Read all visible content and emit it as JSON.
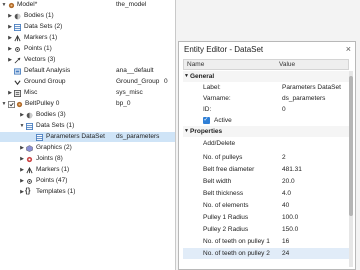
{
  "tree": {
    "rows": [
      {
        "label": "Model*",
        "value": "the_model"
      },
      {
        "label": "Bodies (1)",
        "value": ""
      },
      {
        "label": "Data Sets (2)",
        "value": ""
      },
      {
        "label": "Markers (1)",
        "value": ""
      },
      {
        "label": "Points (1)",
        "value": ""
      },
      {
        "label": "Vectors (3)",
        "value": ""
      },
      {
        "label": "Default Analysis",
        "value": "ana__default"
      },
      {
        "label": "Ground Group",
        "value": "Ground_Group",
        "extra": "0"
      },
      {
        "label": "Misc",
        "value": "sys_misc"
      },
      {
        "label": "BeltPulley 0",
        "value": "bp_0"
      },
      {
        "label": "Bodies (3)",
        "value": ""
      },
      {
        "label": "Data Sets (1)",
        "value": ""
      },
      {
        "label": "Parameters DataSet",
        "value": "ds_parameters"
      },
      {
        "label": "Graphics (2)",
        "value": ""
      },
      {
        "label": "Joints (8)",
        "value": ""
      },
      {
        "label": "Markers (1)",
        "value": ""
      },
      {
        "label": "Points (47)",
        "value": ""
      },
      {
        "label": "Templates (1)",
        "value": ""
      }
    ]
  },
  "dialog": {
    "title": "Entity Editor - DataSet",
    "close_glyph": "×",
    "columns": {
      "name": "Name",
      "value": "Value"
    },
    "general_header": "General",
    "general": [
      {
        "name": "Label:",
        "value": "Parameters DataSet"
      },
      {
        "name": "Varname:",
        "value": "ds_parameters"
      },
      {
        "name": "ID:",
        "value": "0"
      }
    ],
    "active_label": "Active",
    "properties_header": "Properties",
    "add_delete": "Add/Delete",
    "properties": [
      {
        "name": "No. of pulleys",
        "value": "2"
      },
      {
        "name": "Belt free diameter",
        "value": "481.31"
      },
      {
        "name": "Belt width",
        "value": "20.0"
      },
      {
        "name": "Belt thickness",
        "value": "4.0"
      },
      {
        "name": "No. of elements",
        "value": "40"
      },
      {
        "name": "Pulley 1 Radius",
        "value": "100.0"
      },
      {
        "name": "Pulley 2 Radius",
        "value": "150.0"
      },
      {
        "name": "No. of teeth on pulley 1",
        "value": "16"
      },
      {
        "name": "No. of teeth on pulley 2",
        "value": "24"
      }
    ]
  },
  "colors": {
    "selection": "#cfe4f7",
    "highlight": "#e1ecf8",
    "checkbox": "#2f7fd6"
  }
}
